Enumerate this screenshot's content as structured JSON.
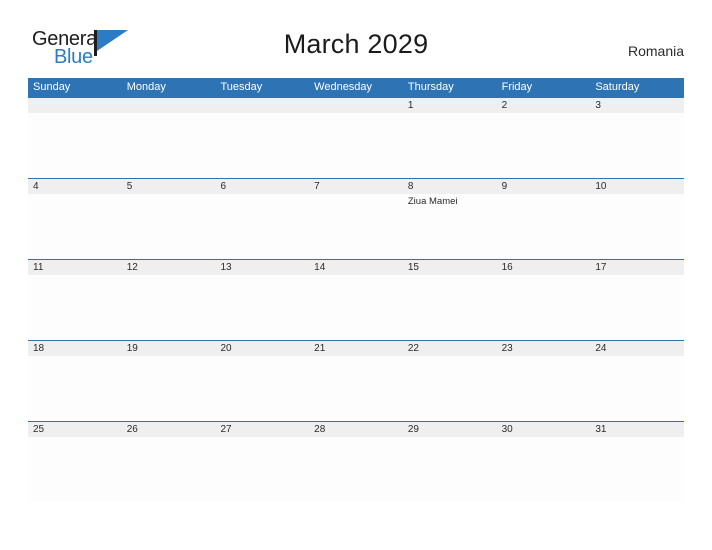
{
  "brand": {
    "name_top": "General",
    "name_bottom": "Blue",
    "flag_color": "#2b7cc4",
    "pole_color": "#1d1d1d",
    "text_top_color": "#1d1d1d",
    "text_bottom_color": "#2b7cc4"
  },
  "header": {
    "title": "March 2029",
    "country": "Romania"
  },
  "theme": {
    "header_blue": "#2e74b5",
    "band_gray": "#efefef",
    "rule_blue": "#2e74b5",
    "page_background": "#ffffff",
    "text_color": "#2b2b2b"
  },
  "weekdays": [
    {
      "label": "Sunday"
    },
    {
      "label": "Monday"
    },
    {
      "label": "Tuesday"
    },
    {
      "label": "Wednesday"
    },
    {
      "label": "Thursday"
    },
    {
      "label": "Friday"
    },
    {
      "label": "Saturday"
    }
  ],
  "weeks": [
    {
      "days": [
        {
          "num": "",
          "events": []
        },
        {
          "num": "",
          "events": []
        },
        {
          "num": "",
          "events": []
        },
        {
          "num": "",
          "events": []
        },
        {
          "num": "1",
          "events": []
        },
        {
          "num": "2",
          "events": []
        },
        {
          "num": "3",
          "events": []
        }
      ]
    },
    {
      "days": [
        {
          "num": "4",
          "events": []
        },
        {
          "num": "5",
          "events": []
        },
        {
          "num": "6",
          "events": []
        },
        {
          "num": "7",
          "events": []
        },
        {
          "num": "8",
          "events": [
            {
              "label": "Ziua Mamei"
            }
          ]
        },
        {
          "num": "9",
          "events": []
        },
        {
          "num": "10",
          "events": []
        }
      ]
    },
    {
      "days": [
        {
          "num": "11",
          "events": []
        },
        {
          "num": "12",
          "events": []
        },
        {
          "num": "13",
          "events": []
        },
        {
          "num": "14",
          "events": []
        },
        {
          "num": "15",
          "events": []
        },
        {
          "num": "16",
          "events": []
        },
        {
          "num": "17",
          "events": []
        }
      ]
    },
    {
      "days": [
        {
          "num": "18",
          "events": []
        },
        {
          "num": "19",
          "events": []
        },
        {
          "num": "20",
          "events": []
        },
        {
          "num": "21",
          "events": []
        },
        {
          "num": "22",
          "events": []
        },
        {
          "num": "23",
          "events": []
        },
        {
          "num": "24",
          "events": []
        }
      ]
    },
    {
      "days": [
        {
          "num": "25",
          "events": []
        },
        {
          "num": "26",
          "events": []
        },
        {
          "num": "27",
          "events": []
        },
        {
          "num": "28",
          "events": []
        },
        {
          "num": "29",
          "events": []
        },
        {
          "num": "30",
          "events": []
        },
        {
          "num": "31",
          "events": []
        }
      ]
    }
  ]
}
